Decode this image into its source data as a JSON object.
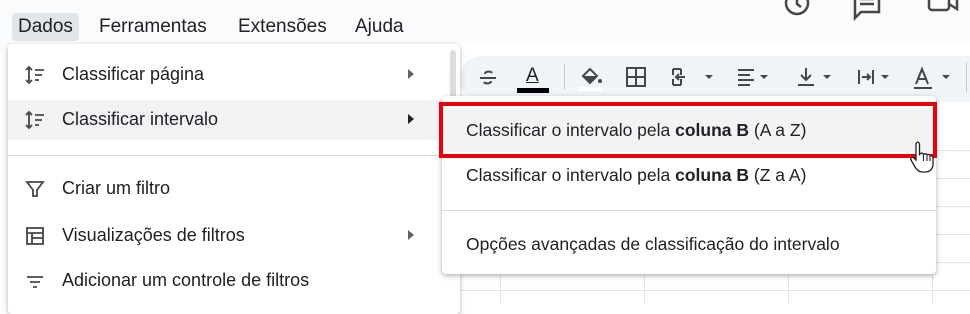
{
  "menubar": {
    "items": [
      "Dados",
      "Ferramentas",
      "Extensões",
      "Ajuda"
    ],
    "active": "Dados",
    "icons": [
      "history-icon",
      "comment-icon",
      "video-icon"
    ]
  },
  "menu": {
    "items": [
      {
        "label": "Classificar página",
        "icon": "sort-icon",
        "submenu": true
      },
      {
        "label": "Classificar intervalo",
        "icon": "sort-icon",
        "submenu": true
      },
      {
        "label": "Criar um filtro",
        "icon": "filter-icon",
        "submenu": false
      },
      {
        "label": "Visualizações de filtros",
        "icon": "filter-views-icon",
        "submenu": true
      },
      {
        "label": "Adicionar um controle de filtros",
        "icon": "filter-control-icon",
        "submenu": false
      }
    ]
  },
  "submenu": {
    "asc": {
      "pre": "Classificar o intervalo pela ",
      "bold": "coluna B",
      "post": " (A a Z)"
    },
    "desc": {
      "pre": "Classificar o intervalo pela ",
      "bold": "coluna B",
      "post": " (Z a A)"
    },
    "advanced": "Opções avançadas de classificação do intervalo"
  },
  "toolbar": {
    "icons": [
      "strikethrough-icon",
      "text-color-icon",
      "fill-color-icon",
      "borders-icon",
      "merge-cells-icon",
      "horizontal-align-icon",
      "vertical-align-icon",
      "text-wrap-icon",
      "text-rotation-icon"
    ],
    "text_color_glyph": "A",
    "text_color": "#000000"
  },
  "colors": {
    "highlight": "#e8000b",
    "active_menu": "#e1e5ea"
  }
}
